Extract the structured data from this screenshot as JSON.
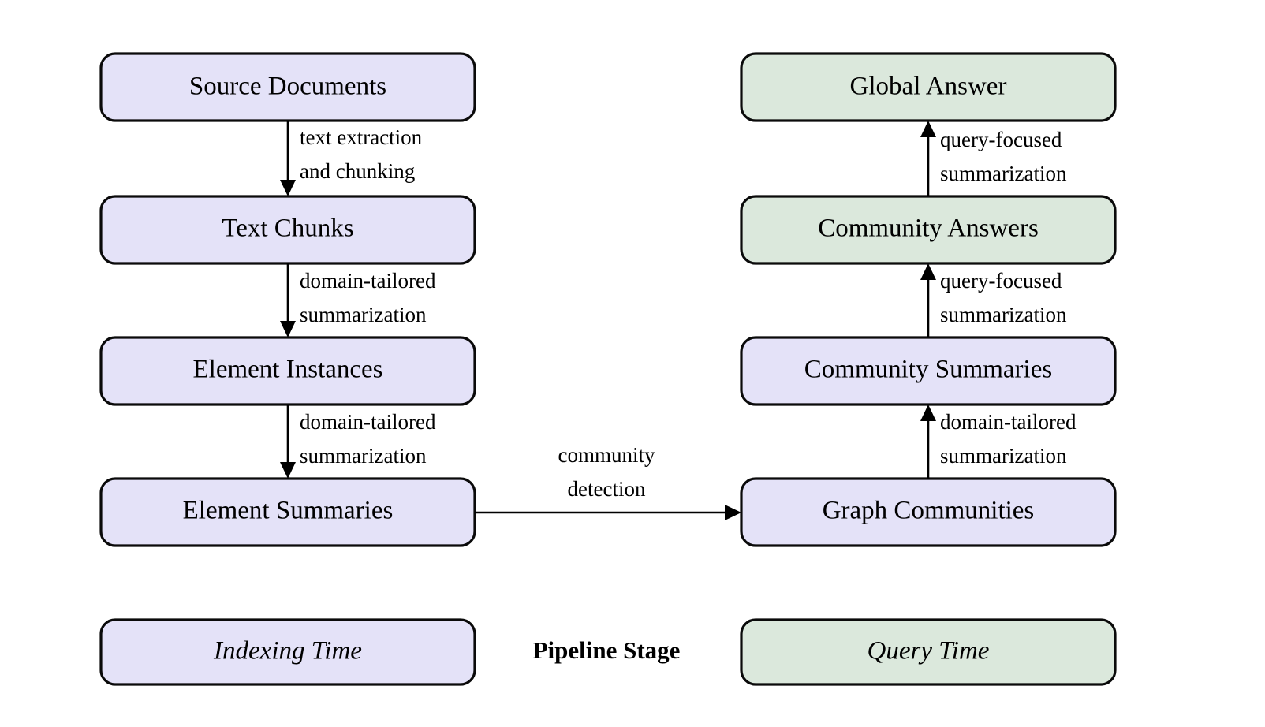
{
  "figure": {
    "kind": "pipeline-flow-diagram",
    "background_color": "#ffffff",
    "colors": {
      "indexing_fill": "#e4e2f8",
      "query_fill": "#dbe8dc",
      "stroke": "#0a0a0a",
      "text": "#000000"
    }
  },
  "nodes": {
    "source_documents": "Source Documents",
    "text_chunks": "Text Chunks",
    "element_instances": "Element Instances",
    "element_summaries": "Element Summaries",
    "graph_communities": "Graph Communities",
    "community_summaries": "Community Summaries",
    "community_answers": "Community Answers",
    "global_answer": "Global Answer"
  },
  "edges": {
    "text_extraction": {
      "line1": "text extraction",
      "line2": "and chunking"
    },
    "domain_summarization_1": {
      "line1": "domain-tailored",
      "line2": "summarization"
    },
    "domain_summarization_2": {
      "line1": "domain-tailored",
      "line2": "summarization"
    },
    "community_detection": {
      "line1": "community",
      "line2": "detection"
    },
    "domain_summarization_3": {
      "line1": "domain-tailored",
      "line2": "summarization"
    },
    "query_summarization_1": {
      "line1": "query-focused",
      "line2": "summarization"
    },
    "query_summarization_2": {
      "line1": "query-focused",
      "line2": "summarization"
    }
  },
  "legend": {
    "indexing_time": "Indexing Time",
    "pipeline_stage": "Pipeline Stage",
    "query_time": "Query Time"
  }
}
